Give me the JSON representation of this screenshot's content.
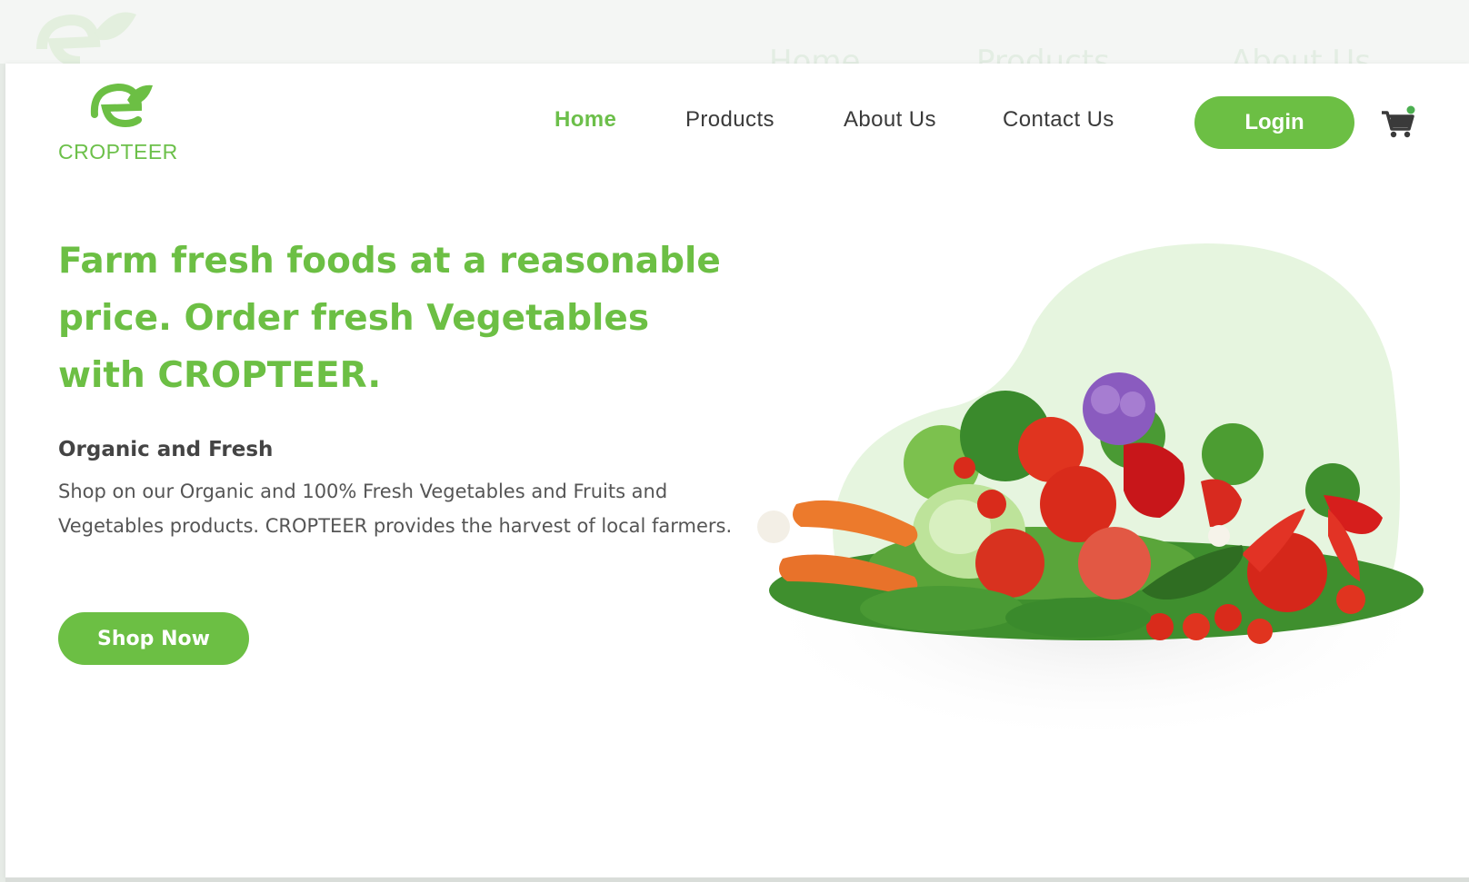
{
  "brand": {
    "name": "CROPTEER",
    "logo_icon": "leaf-e-icon"
  },
  "nav": {
    "items": [
      {
        "label": "Home",
        "active": true
      },
      {
        "label": "Products",
        "active": false
      },
      {
        "label": "About Us",
        "active": false
      },
      {
        "label": "Contact Us",
        "active": false
      }
    ],
    "login_label": "Login",
    "cart_icon": "cart-icon"
  },
  "hero": {
    "title": "Farm fresh foods at a reasonable price. Order fresh Vegetables with CROPTEER.",
    "subtitle": "Organic and Fresh",
    "description": "Shop on our Organic and 100% Fresh Vegetables and Fruits and Vegetables products.  CROPTEER provides the harvest of local farmers.",
    "cta_label": "Shop Now",
    "image": "vegetables-image"
  },
  "ghost_nav": [
    "Home",
    "Products",
    "About Us"
  ],
  "colors": {
    "brand_green": "#6cbf44",
    "blob_green": "#e6f5df",
    "text_dark": "#3a3a3a"
  }
}
